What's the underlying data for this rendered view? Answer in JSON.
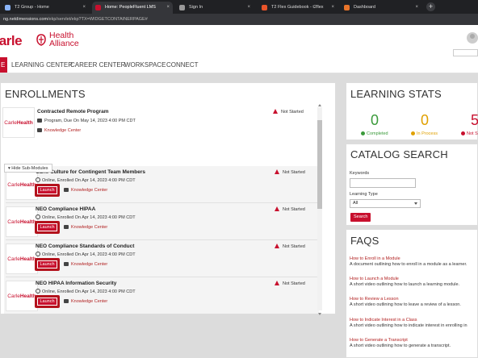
{
  "browser": {
    "tabs": [
      {
        "title": "T2 Group - Home",
        "color": "#8ab4f8"
      },
      {
        "title": "Home: PeopleFluent LMS",
        "color": "#c8102e"
      },
      {
        "title": "Sign In",
        "color": "#999999"
      },
      {
        "title": "T2 Flex Guidebook - t2flex",
        "color": "#e8542a"
      },
      {
        "title": "Dashboard",
        "color": "#e8742a"
      }
    ],
    "new_tab_label": "+",
    "tab_close_glyph": "×",
    "url_host": "ng.netdimensions.com",
    "url_path": "/ekp/servlet/ekp?TX=WIDGETCONTAINERPAGE#"
  },
  "header": {
    "logo_carle": "Carle",
    "logo_health": "Health",
    "logo_alliance": "Alliance"
  },
  "nav": {
    "home": "E",
    "items": [
      "LEARNING CENTER",
      "CAREER CENTER",
      "WORKSPACE",
      "CONNECT"
    ]
  },
  "enrollments": {
    "title": "ENROLLMENTS",
    "hide_label": "Hide Sub-Modules",
    "knowledge_center": "Knowledge Center",
    "launch_label": "Launch",
    "logo_prefix": "Carle",
    "logo_suffix": "Health",
    "program": {
      "name": "Contracted Remote Program",
      "detail": "Program, Due On May 14, 2023 4:00 PM CDT",
      "status": "Not Started"
    },
    "modules": [
      {
        "name": "Carle Culture for Contingent Team Members",
        "detail": "Online, Enrolled On Apr 14, 2023 4:00 PM CDT",
        "status": "Not Started"
      },
      {
        "name": "NEO Compliance HIPAA",
        "detail": "Online, Enrolled On Apr 14, 2023 4:00 PM CDT",
        "status": "Not Started"
      },
      {
        "name": "NEO Compliance Standards of Conduct",
        "detail": "Online, Enrolled On Apr 14, 2023 4:00 PM CDT",
        "status": "Not Started"
      },
      {
        "name": "NEO HIPAA Information Security",
        "detail": "Online, Enrolled On Apr 14, 2023 4:00 PM CDT",
        "status": "Not Started"
      }
    ]
  },
  "stats": {
    "title": "LEARNING STATS",
    "items": [
      {
        "value": "0",
        "label": "Completed",
        "color": "#3a9a3a"
      },
      {
        "value": "0",
        "label": "In Process",
        "color": "#e0a000"
      },
      {
        "value": "5",
        "label": "Not S",
        "color": "#c8102e"
      }
    ]
  },
  "catalog": {
    "title": "CATALOG SEARCH",
    "keywords_label": "Keywords",
    "type_label": "Learning Type",
    "type_value": "All",
    "search_label": "Search"
  },
  "faqs": {
    "title": "FAQS",
    "items": [
      {
        "link": "How to Enroll in a Module",
        "desc": "A document outlining how to enroll in a module as a learner."
      },
      {
        "link": "How to Launch a Module",
        "desc": "A short video outlining how to launch a learning module."
      },
      {
        "link": "How to Review a Lesson",
        "desc": "A short video outlining how to leave a review of a lesson."
      },
      {
        "link": "How to Indicate Interest in a Class",
        "desc": "A short video outlining how to indicate interest in enrolling in"
      },
      {
        "link": "How to Generate a Transcript",
        "desc": "A short video outlining how to generate a transcript."
      }
    ]
  },
  "colors": {
    "brand": "#c8102e",
    "completed": "#3a9a3a",
    "in_process": "#e0a000"
  }
}
